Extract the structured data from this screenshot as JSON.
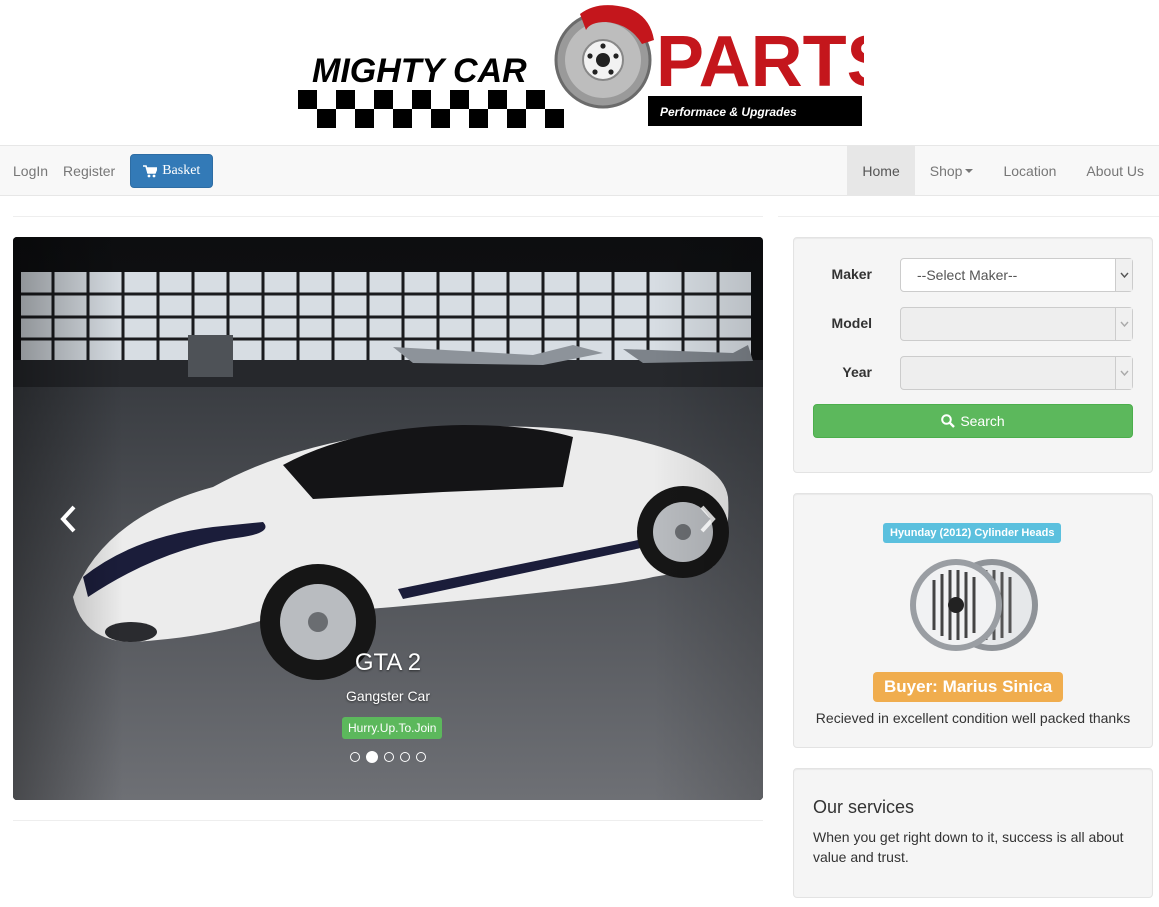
{
  "brand": {
    "logo_text_1": "MIGHTY CAR",
    "logo_text_2": "PARTS",
    "logo_tagline": "Performace & Upgrades"
  },
  "nav": {
    "login": "LogIn",
    "register": "Register",
    "basket": "Basket",
    "items": [
      "Home",
      "Shop",
      "Location",
      "About Us"
    ],
    "active": "Home"
  },
  "carousel": {
    "title": "GTA 2",
    "subtitle": "Gangster Car",
    "badge": "Hurry.Up.To.Join",
    "slide_count": 5,
    "active_index": 1
  },
  "search_form": {
    "maker_label": "Maker",
    "maker_value": "--Select Maker--",
    "model_label": "Model",
    "year_label": "Year",
    "search_button": "Search"
  },
  "review": {
    "product": "Hyunday (2012) Cylinder Heads",
    "buyer": "Buyer: Marius Sinica",
    "text": "Recieved in excellent condition well packed thanks"
  },
  "services": {
    "title": "Our services",
    "text": "When you get right down to it, success is all about value and trust."
  },
  "colors": {
    "primary": "#337ab7",
    "success": "#5cb85c",
    "info": "#5bc0de",
    "warning": "#f0ad4e",
    "logo_red": "#c4161c"
  }
}
